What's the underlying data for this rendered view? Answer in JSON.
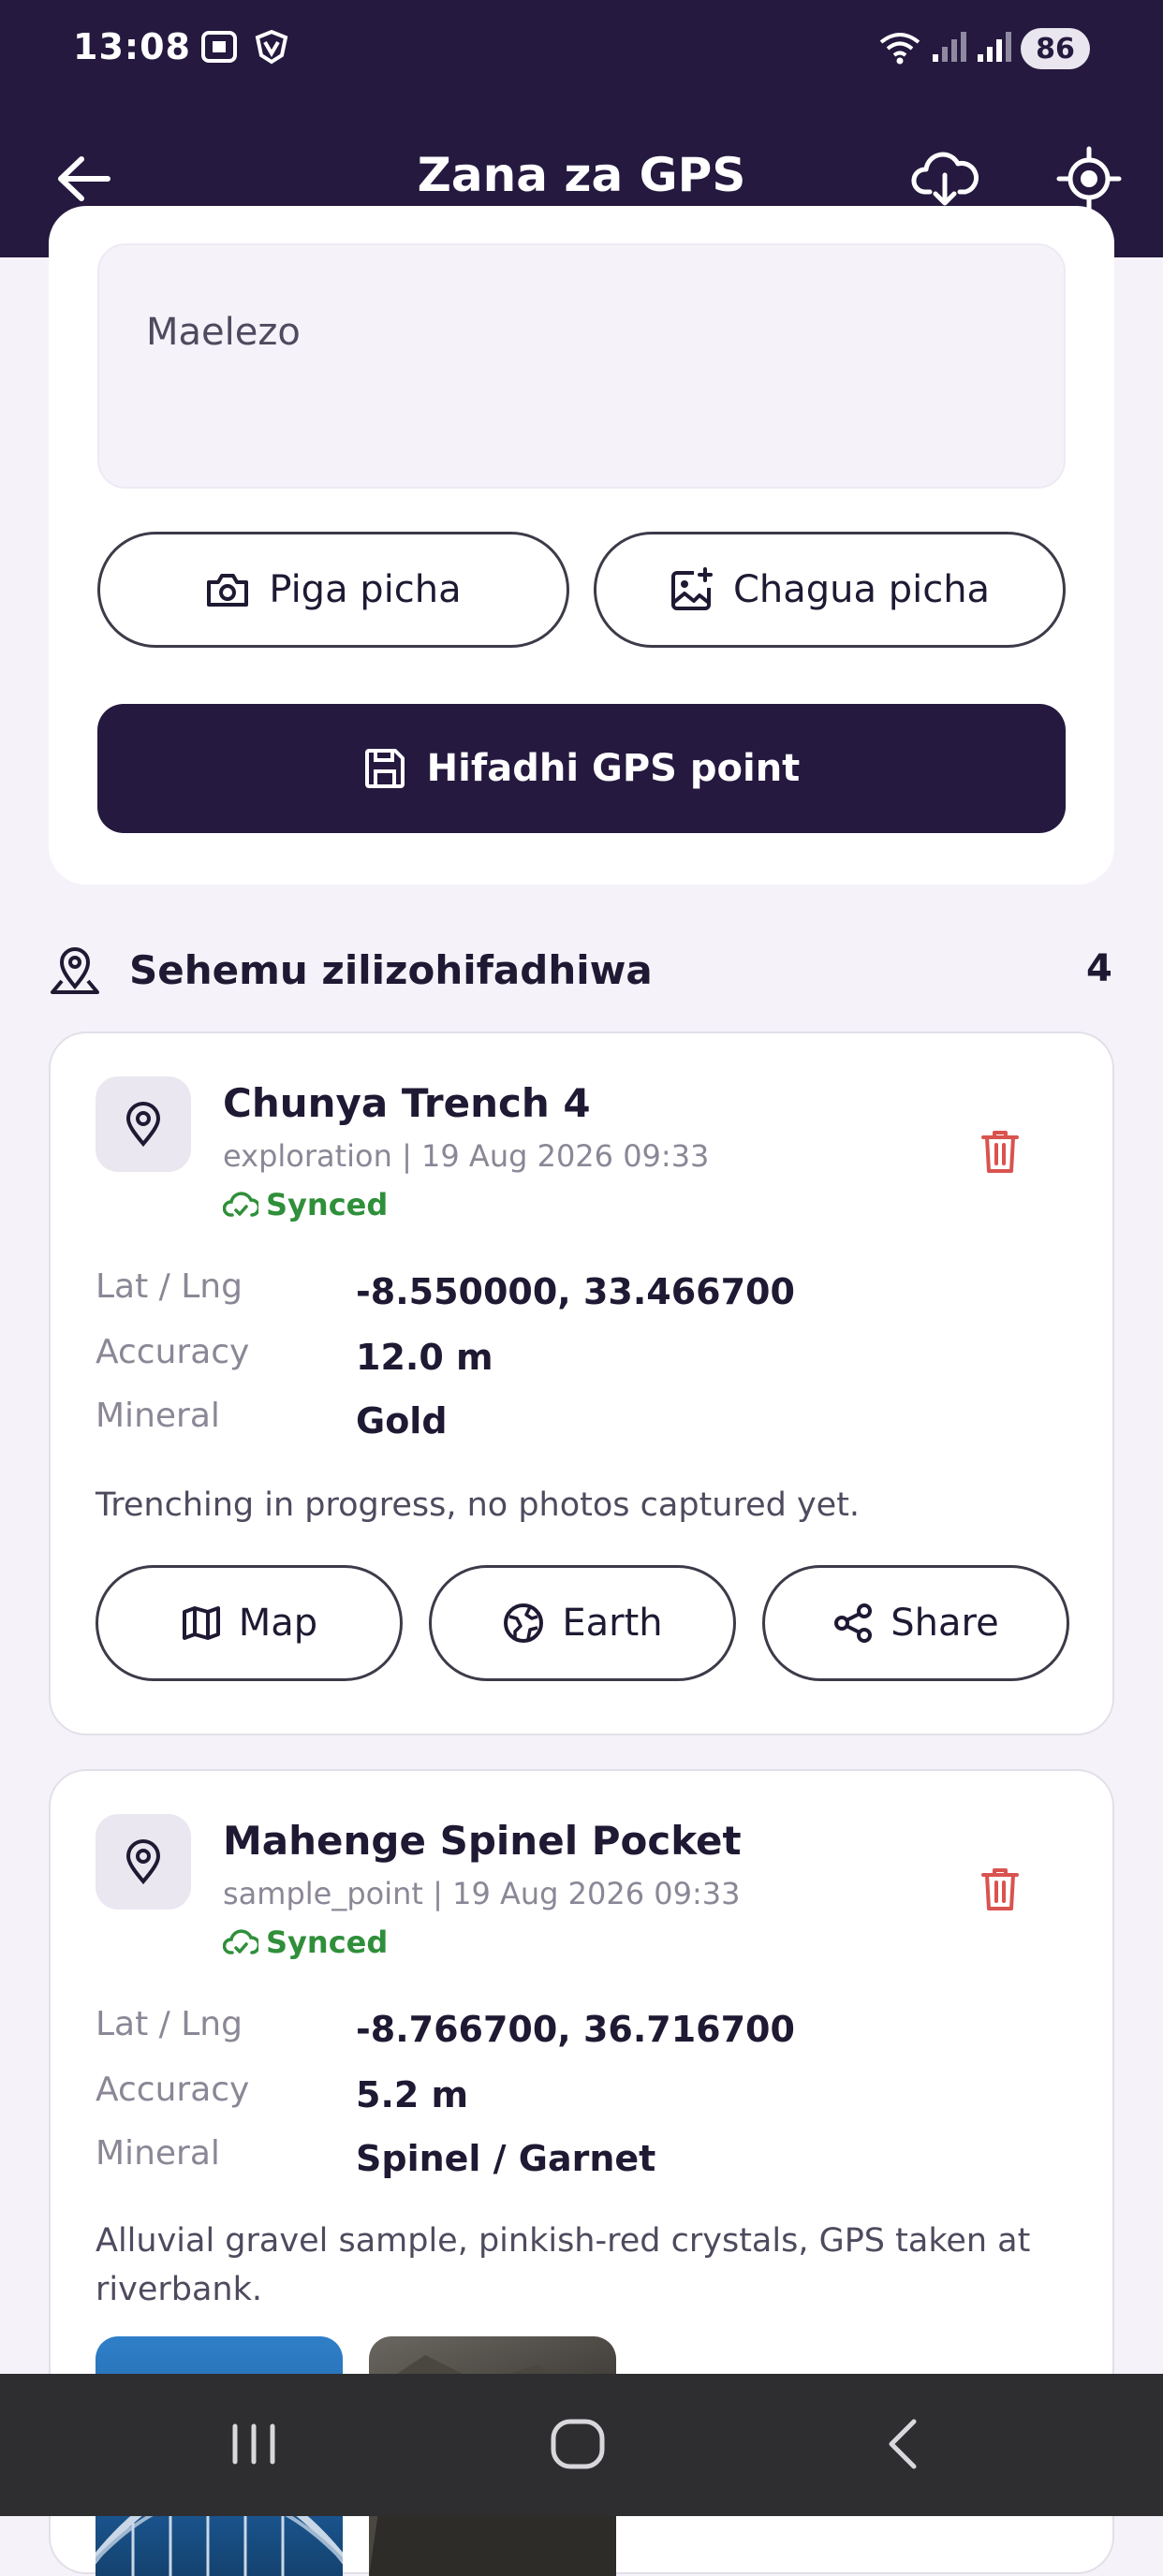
{
  "status_bar": {
    "time": "13:08",
    "battery": "86",
    "icons": [
      "screenshot-icon",
      "vpn-icon",
      "wifi-icon",
      "signal-icon",
      "signal-icon"
    ]
  },
  "app_bar": {
    "title": "Zana za GPS",
    "back_icon": "arrow-left-icon",
    "download_icon": "cloud-download-icon",
    "location_icon": "gps-target-icon"
  },
  "form": {
    "description_placeholder": "Maelezo",
    "take_photo_label": "Piga picha",
    "choose_photo_label": "Chagua picha",
    "save_label": "Hifadhi GPS point"
  },
  "saved_section": {
    "title": "Sehemu zilizohifadhiwa",
    "count": "4"
  },
  "points": [
    {
      "name": "Chunya Trench 4",
      "meta": "exploration | 19 Aug 2026 09:33",
      "sync_status": "Synced",
      "fields": [
        {
          "label": "Lat / Lng",
          "value": "-8.550000, 33.466700"
        },
        {
          "label": "Accuracy",
          "value": "12.0 m"
        },
        {
          "label": "Mineral",
          "value": "Gold"
        }
      ],
      "note": "Trenching in progress, no photos captured yet.",
      "actions": [
        "Map",
        "Earth",
        "Share"
      ]
    },
    {
      "name": "Mahenge Spinel Pocket",
      "meta": "sample_point | 19 Aug 2026 09:33",
      "sync_status": "Synced",
      "fields": [
        {
          "label": "Lat / Lng",
          "value": "-8.766700, 36.716700"
        },
        {
          "label": "Accuracy",
          "value": "5.2 m"
        },
        {
          "label": "Mineral",
          "value": "Spinel / Garnet"
        }
      ],
      "note_line1": "Alluvial gravel sample, pinkish-red crystals, GPS taken at",
      "note_line2": "riverbank."
    }
  ],
  "colors": {
    "primary": "#25193f",
    "synced": "#2f8f3a",
    "delete": "#d9534f",
    "background": "#f5f2fa"
  }
}
